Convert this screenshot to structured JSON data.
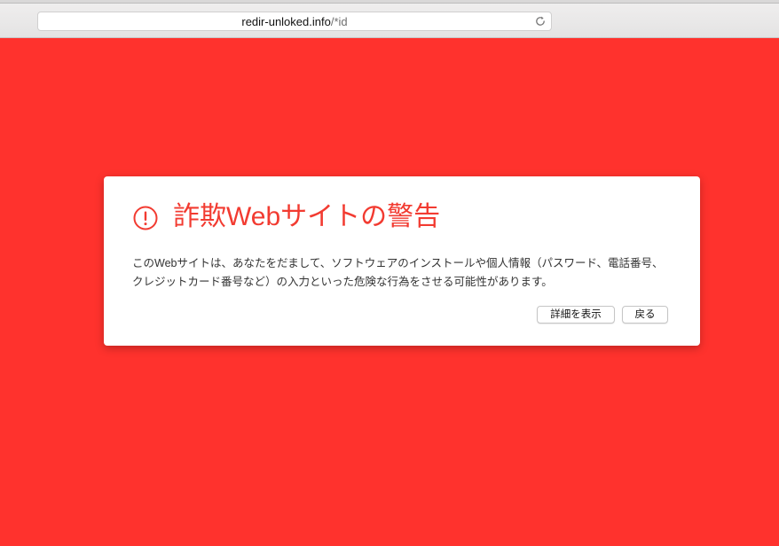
{
  "browser": {
    "url_host": "redir-unloked.info",
    "url_path": "/*id"
  },
  "warning": {
    "title": "詐欺Webサイトの警告",
    "body": "このWebサイトは、あなたをだまして、ソフトウェアのインストールや個人情報（パスワード、電話番号、クレジットカード番号など）の入力といった危険な行為をさせる可能性があります。",
    "details_button": "詳細を表示",
    "back_button": "戻る"
  },
  "colors": {
    "page_background": "#ff322d",
    "title_red": "#f23b31"
  },
  "icons": {
    "warning": "exclamation-circle-icon",
    "reload": "reload-icon"
  }
}
